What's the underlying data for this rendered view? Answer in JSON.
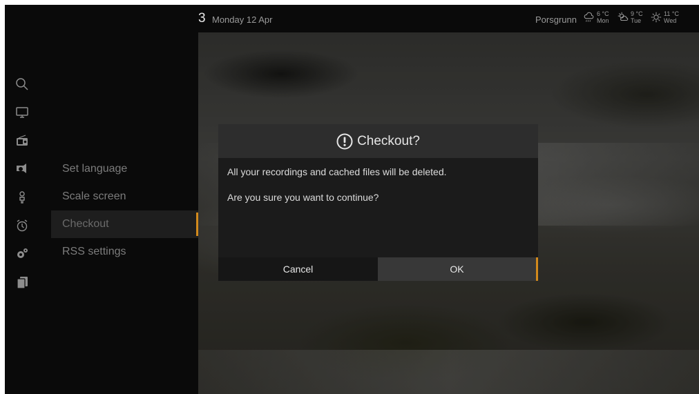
{
  "header": {
    "channel_number": "3",
    "date": "Monday 12 Apr",
    "location": "Porsgrunn",
    "forecast": [
      {
        "icon": "rain-cloud-icon",
        "temp": "6 °C",
        "day": "Mon"
      },
      {
        "icon": "partly-cloudy-icon",
        "temp": "9 °C",
        "day": "Tue"
      },
      {
        "icon": "sun-icon",
        "temp": "11 °C",
        "day": "Wed"
      }
    ]
  },
  "sidebar_icons": [
    "search-icon",
    "tv-icon",
    "radio-icon",
    "media-icon",
    "person-icon",
    "alarm-clock-icon",
    "settings-gear-icon",
    "copy-pages-icon"
  ],
  "settings_menu": {
    "items": [
      {
        "label": "Set language"
      },
      {
        "label": "Scale screen"
      },
      {
        "label": "Checkout",
        "selected": true
      },
      {
        "label": "RSS settings"
      }
    ]
  },
  "dialog": {
    "title": "Checkout?",
    "icon": "alert-icon",
    "line1": "All your recordings and cached files will be deleted.",
    "line2": "Are you sure you want to continue?",
    "cancel_label": "Cancel",
    "ok_label": "OK"
  },
  "colors": {
    "accent": "#d38a1c",
    "background": "#0a0a0a",
    "dialog_header": "#2d2d2d",
    "dialog_body": "#1b1b1b"
  }
}
